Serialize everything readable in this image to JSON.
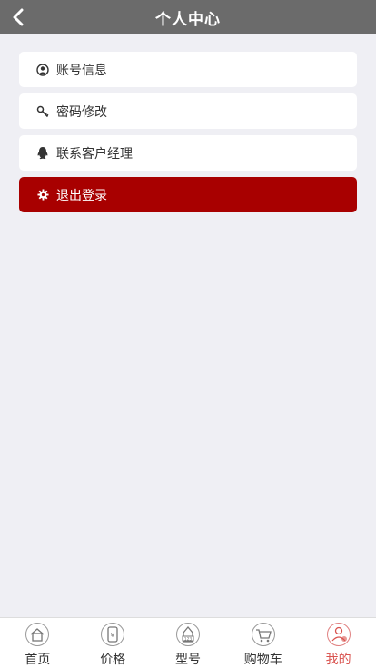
{
  "header": {
    "title": "个人中心",
    "back_icon": "chevron-left-icon"
  },
  "menu": {
    "items": [
      {
        "label": "账号信息",
        "icon": "user-circle-icon"
      },
      {
        "label": "密码修改",
        "icon": "key-icon"
      },
      {
        "label": "联系客户经理",
        "icon": "qq-icon"
      }
    ],
    "logout": {
      "label": "退出登录",
      "icon": "gear-icon",
      "color": "#a80000"
    }
  },
  "tabbar": {
    "tabs": [
      {
        "label": "首页",
        "icon": "home-icon"
      },
      {
        "label": "价格",
        "icon": "price-tag-icon"
      },
      {
        "label": "型号",
        "icon": "model-tag-icon"
      },
      {
        "label": "购物车",
        "icon": "cart-icon"
      },
      {
        "label": "我的",
        "icon": "user-icon",
        "active": true
      }
    ],
    "active_color": "#d9534f"
  }
}
